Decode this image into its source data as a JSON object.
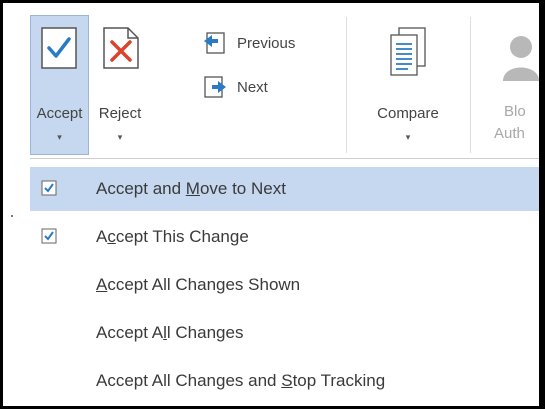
{
  "ribbon": {
    "accept": {
      "label": "Accept",
      "caret": "▾"
    },
    "reject": {
      "label": "Reject",
      "caret": "▾"
    },
    "previous": {
      "label": "Previous"
    },
    "next": {
      "label": "Next"
    },
    "compare": {
      "label": "Compare",
      "caret": "▾"
    },
    "block_authors": {
      "label_line1": "Blo",
      "label_line2": "Auth"
    }
  },
  "menu": {
    "items": [
      {
        "pre": "Accept and ",
        "ul": "M",
        "post": "ove to Next",
        "checked": true,
        "highlighted": true
      },
      {
        "pre": "A",
        "ul": "c",
        "post": "cept This Change",
        "checked": true,
        "highlighted": false
      },
      {
        "pre": "",
        "ul": "A",
        "post": "ccept All Changes Shown",
        "checked": false,
        "highlighted": false
      },
      {
        "pre": "Accept A",
        "ul": "l",
        "post": "l Changes",
        "checked": false,
        "highlighted": false
      },
      {
        "pre": "Accept All Changes and ",
        "ul": "S",
        "post": "top Tracking",
        "checked": false,
        "highlighted": false
      }
    ]
  },
  "colors": {
    "accent": "#2b7bc4",
    "highlight": "#c5d8ef",
    "reject_red": "#d9442c"
  }
}
